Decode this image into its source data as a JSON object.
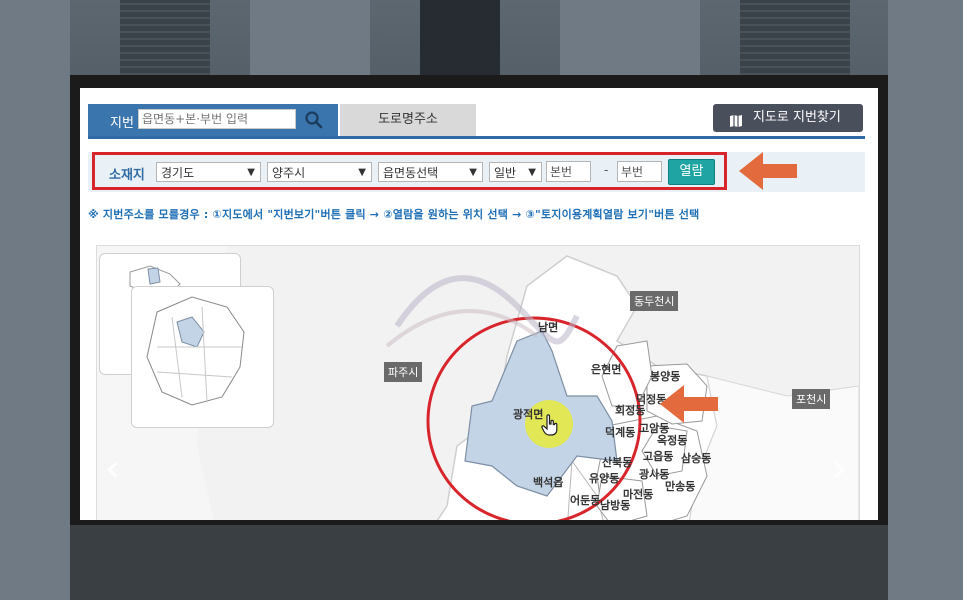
{
  "search": {
    "jibun_tab_label": "지번",
    "jibun_placeholder": "읍면동+본·부번 입력",
    "road_tab_label": "도로명주소",
    "map_find_button": "지도로 지번찾기"
  },
  "location": {
    "label": "소재지",
    "province": "경기도",
    "city": "양주시",
    "town": "읍면동선택",
    "lot_type": "일반",
    "main_number_placeholder": "본번",
    "dash": "-",
    "sub_number_placeholder": "부번",
    "view_button": "열람"
  },
  "hint": "※ 지번주소를 모를경우 : ①지도에서 \"지번보기\"버튼 클릭 → ②열람을 원하는 위치 선택 → ③\"토지이용계획열람 보기\"버튼 선택",
  "map": {
    "city_tags": [
      "동두천시",
      "파주시",
      "포천시"
    ],
    "regions": [
      "남면",
      "은현면",
      "광적면",
      "백석읍",
      "봉양동",
      "회정동",
      "덕정동",
      "덕계동",
      "고암동",
      "옥정동",
      "삼숭동",
      "고읍동",
      "산북동",
      "광사동",
      "유양동",
      "만송동",
      "마전동",
      "어둔동",
      "남방동"
    ]
  },
  "colors": {
    "accent_blue": "#3b75ad",
    "highlight_red": "#d8252b",
    "view_button": "#1fa3a3",
    "arrow_orange": "#e36a3c",
    "selected_region": "#c3d4e6"
  }
}
